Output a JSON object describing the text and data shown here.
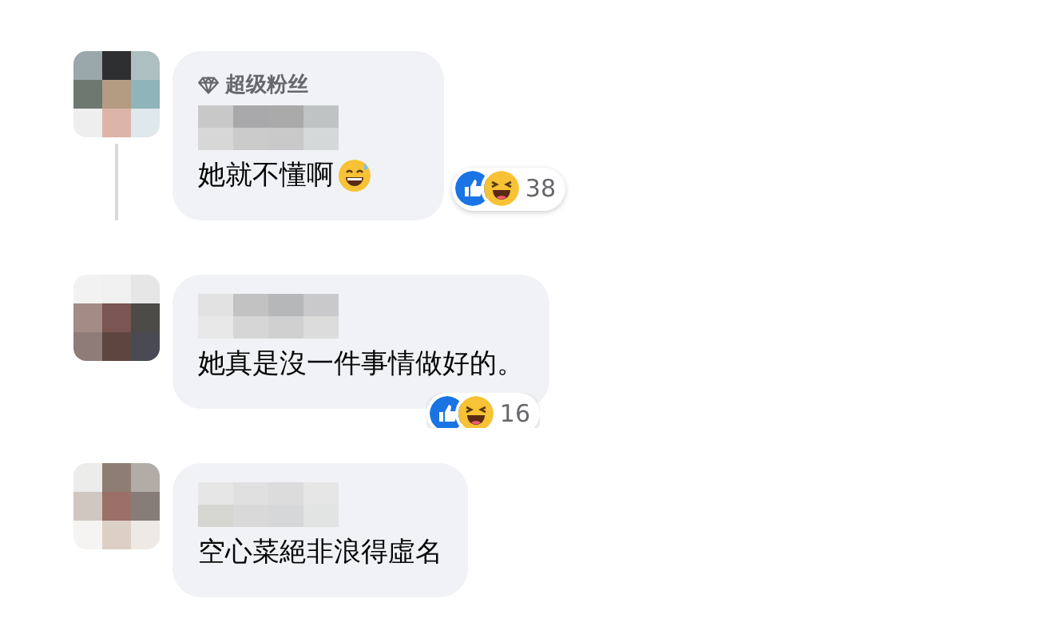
{
  "comments": [
    {
      "badge": "超级粉丝",
      "text": "她就不懂啊",
      "trailing_icon": {
        "kind": "grin_sweat"
      },
      "reactions": {
        "icons": [
          {
            "kind": "like"
          },
          {
            "kind": "haha"
          }
        ],
        "count": "38"
      },
      "thread_line": true
    },
    {
      "text": "她真是沒一件事情做好的。",
      "reactions": {
        "icons": [
          {
            "kind": "like"
          },
          {
            "kind": "haha"
          }
        ],
        "count": "16"
      },
      "thread_line": false
    },
    {
      "text": "空心菜絕非浪得虛名",
      "thread_line": false
    }
  ]
}
